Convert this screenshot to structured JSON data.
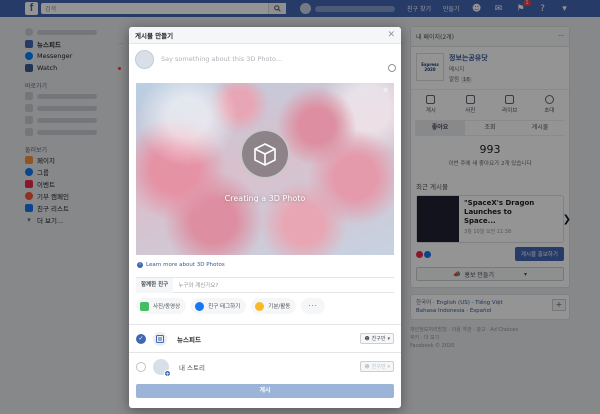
{
  "topbar": {
    "search_placeholder": "검색",
    "links": [
      "친구 찾기",
      "만들기"
    ],
    "notification_count": "1"
  },
  "left": {
    "news_feed": "뉴스피드",
    "messenger": "Messenger",
    "watch": "Watch",
    "shortcuts_title": "바로가기",
    "explore_title": "둘러보기",
    "explore_items": [
      "페이지",
      "그룹",
      "이벤트",
      "기부 캠페인",
      "친구 리스트"
    ],
    "see_more": "더 보기..."
  },
  "right": {
    "page_header": "내 페이지(2개)",
    "page_name": "정보는공유닷",
    "page_logo_text": "Express 2020",
    "page_sub1": "메시지",
    "page_sub2": "알림",
    "page_sub2_count": "16",
    "actions": [
      "게시",
      "사진",
      "라이브",
      "초대"
    ],
    "tabs": [
      "좋아요",
      "조회",
      "게시물"
    ],
    "stat_value": "993",
    "stat_sub": "이번 주에 새 좋아요가 2개 있습니다",
    "recent_posts_title": "최근 게시물",
    "post_title": "\"SpaceX's Dragon Launches to Space...",
    "post_meta": "3월 10일 오전 11:38",
    "boost_button": "게시물 홍보하기",
    "promote_button": "홍보 만들기",
    "lang_prefix": "한국어 · ",
    "lang_links": "English (US) · Tiếng Việt",
    "lang_line2": "Bahasa Indonesia · Español",
    "footer_line1": "개인정보처리방침 · 이용 약관 · 광고 · Ad Choices",
    "footer_line2": "쿠키 · 더 보기 ·",
    "footer_line3": "Facebook © 2020"
  },
  "modal": {
    "title": "게시물 만들기",
    "compose_placeholder": "Say something about this 3D Photo...",
    "creating_text": "Creating a 3D Photo",
    "learn_more": "Learn more about 3D Photos",
    "tag_label": "함께한 친구",
    "tag_placeholder": "누구와 계신가요?",
    "chips": [
      "사진/동영상",
      "친구 태그하기",
      "기분/활동"
    ],
    "more_chip": "···",
    "dest_feed": "뉴스피드",
    "dest_story": "내 스토리",
    "audience": "친구만",
    "post_button": "게시"
  },
  "colors": {
    "brand": "#4267b2",
    "overlay": "rgba(0,0,0,0.42)"
  }
}
